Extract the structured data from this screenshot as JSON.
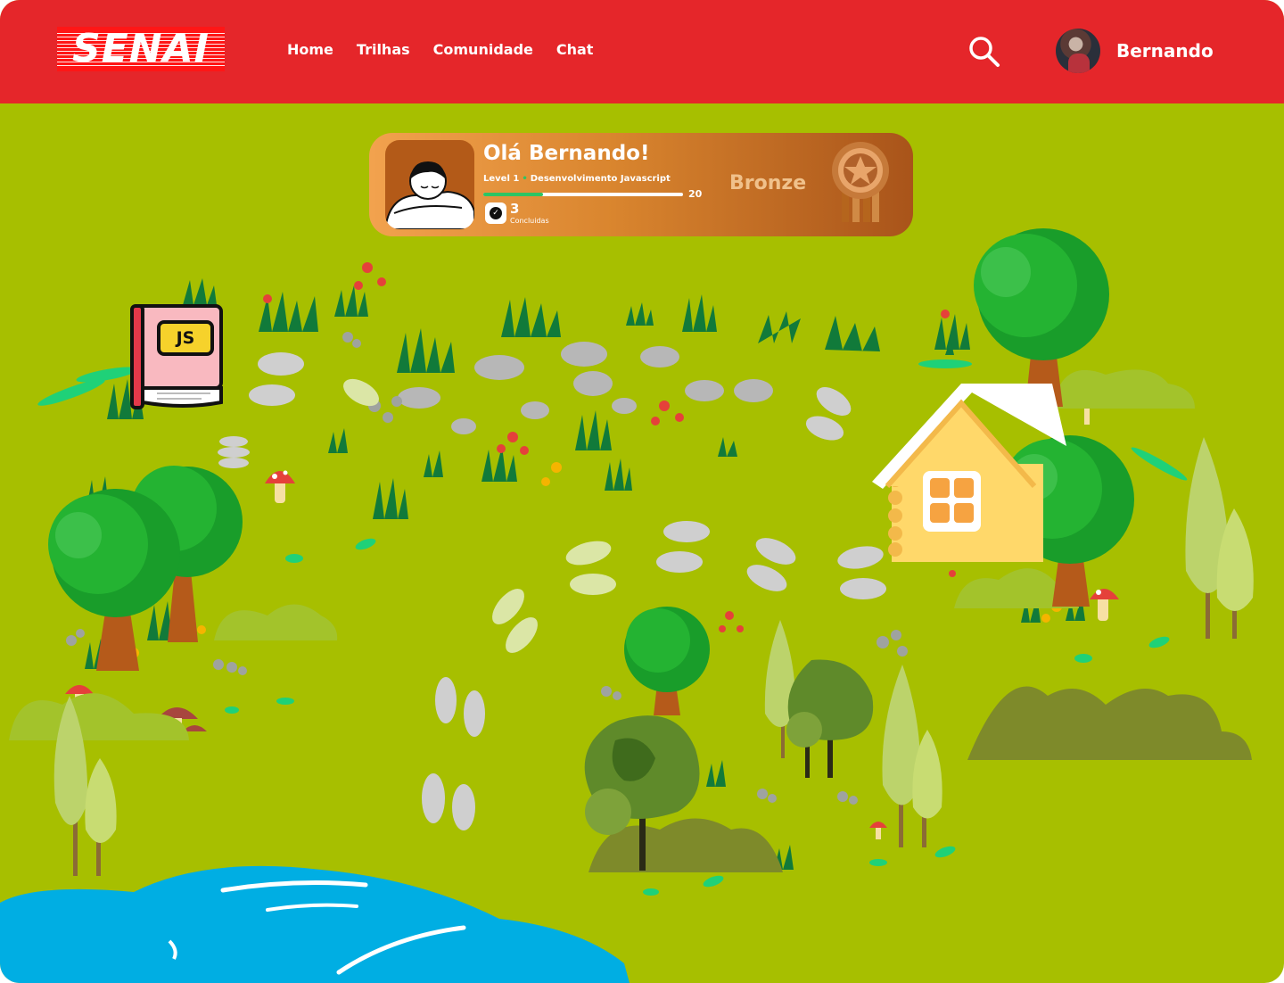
{
  "header": {
    "logo_text": "SENAI",
    "nav": [
      {
        "label": "Home"
      },
      {
        "label": "Trilhas"
      },
      {
        "label": "Comunidade"
      },
      {
        "label": "Chat"
      }
    ],
    "search_icon": "search-icon",
    "user_name": "Bernando"
  },
  "profile_card": {
    "greeting": "Olá Bernando!",
    "level": "Level 1",
    "track": "Desenvolvimento Javascript",
    "progress_fraction": 0.3,
    "progress_max": "20",
    "completed_count": "3",
    "completed_label": "Concluidas",
    "tier": "Bronze"
  },
  "map": {
    "lesson_book_label": "JS",
    "icons": [
      "tree-icon",
      "house-icon",
      "footprints-icon",
      "mushroom-icon",
      "lake-icon",
      "grass-icon"
    ]
  },
  "colors": {
    "header": "#e5262a",
    "ground": "#a7bf00",
    "lake": "#00aee3",
    "card_start": "#f2a24e",
    "card_end": "#a9541a"
  }
}
